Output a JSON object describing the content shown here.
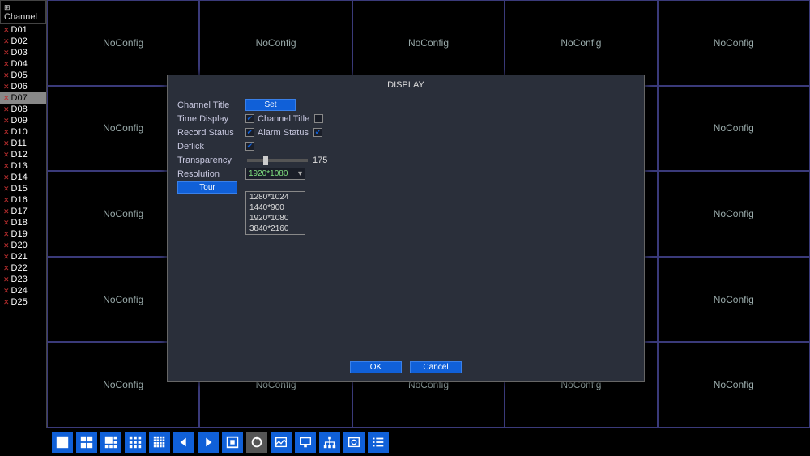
{
  "sidebar": {
    "header": "Channel",
    "items": [
      {
        "label": "D01"
      },
      {
        "label": "D02"
      },
      {
        "label": "D03"
      },
      {
        "label": "D04"
      },
      {
        "label": "D05"
      },
      {
        "label": "D06"
      },
      {
        "label": "D07",
        "selected": true
      },
      {
        "label": "D08"
      },
      {
        "label": "D09"
      },
      {
        "label": "D10"
      },
      {
        "label": "D11"
      },
      {
        "label": "D12"
      },
      {
        "label": "D13"
      },
      {
        "label": "D14"
      },
      {
        "label": "D15"
      },
      {
        "label": "D16"
      },
      {
        "label": "D17"
      },
      {
        "label": "D18"
      },
      {
        "label": "D19"
      },
      {
        "label": "D20"
      },
      {
        "label": "D21"
      },
      {
        "label": "D22"
      },
      {
        "label": "D23"
      },
      {
        "label": "D24"
      },
      {
        "label": "D25"
      }
    ]
  },
  "grid": {
    "cell_text": "NoConfig"
  },
  "dialog": {
    "title": "DISPLAY",
    "channel_title_label": "Channel Title",
    "set_btn": "Set",
    "time_display_label": "Time Display",
    "channel_title_cb_label": "Channel Title",
    "record_status_label": "Record Status",
    "alarm_status_label": "Alarm Status",
    "deflick_label": "Deflick",
    "transparency_label": "Transparency",
    "transparency_value": "175",
    "resolution_label": "Resolution",
    "resolution_value": "1920*1080",
    "tour_btn": "Tour",
    "dropdown": [
      "1280*1024",
      "1440*900",
      "1920*1080",
      "3840*2160"
    ],
    "ok_btn": "OK",
    "cancel_btn": "Cancel"
  }
}
